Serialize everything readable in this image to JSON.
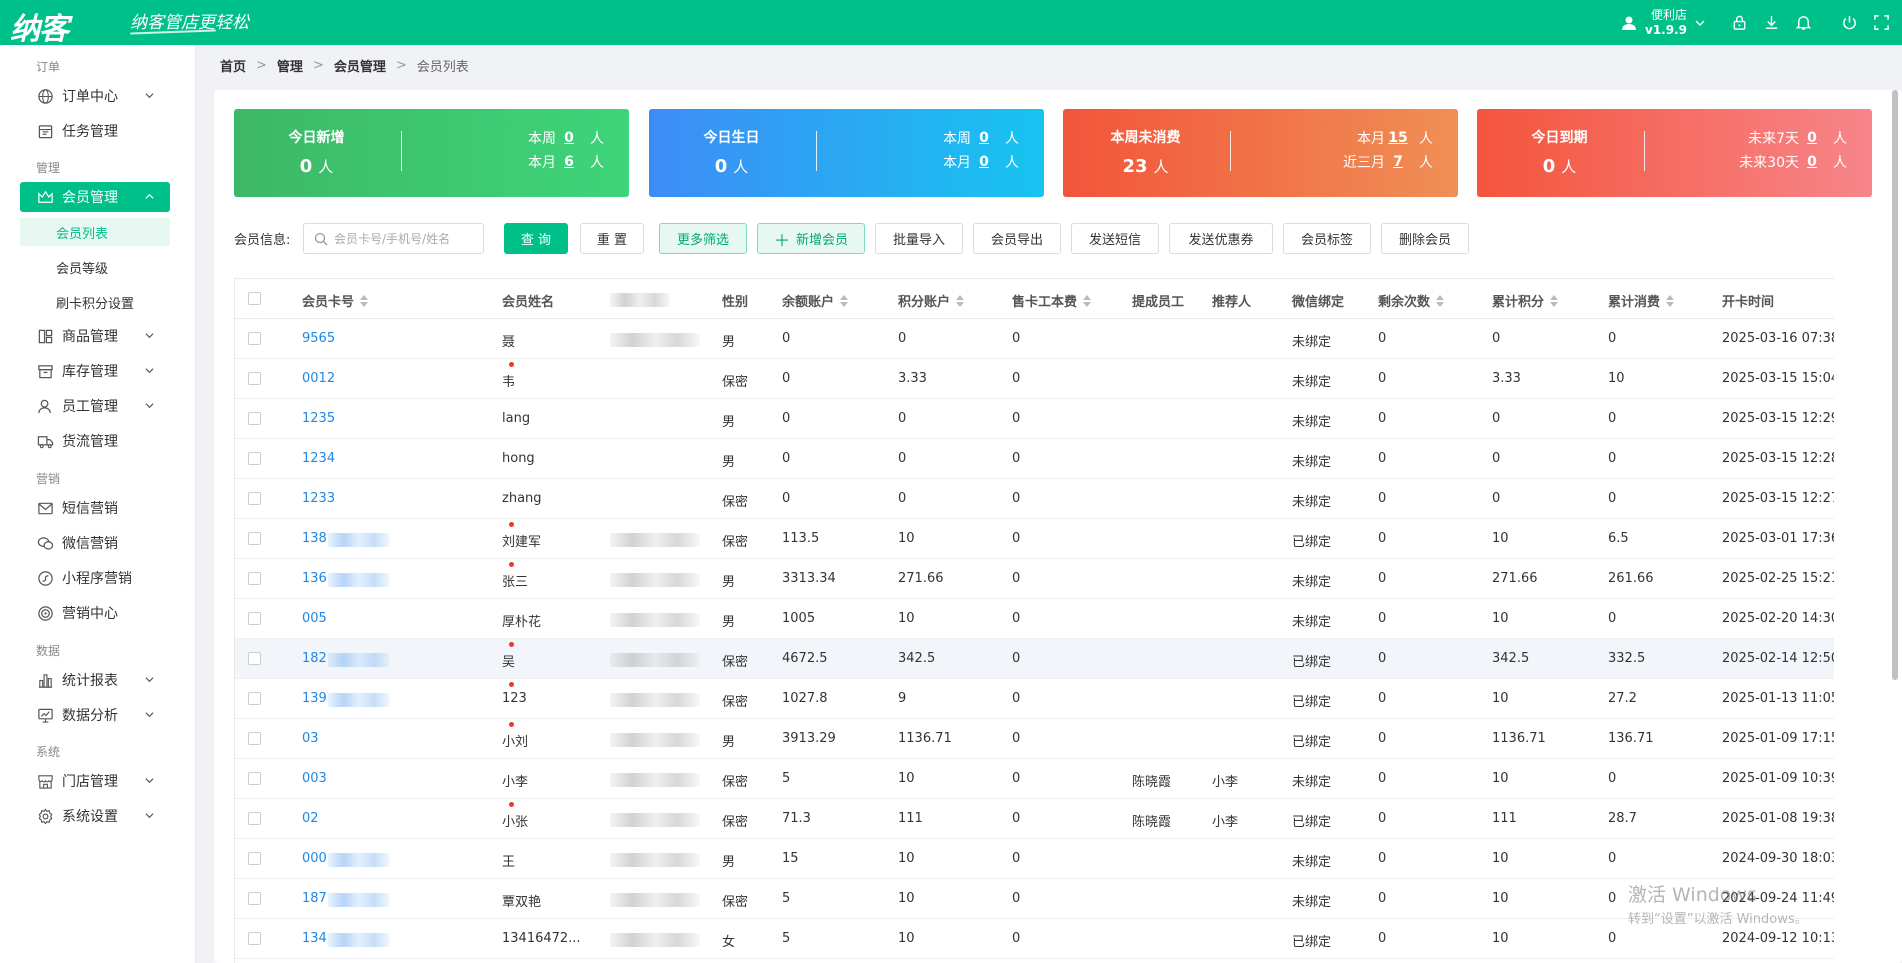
{
  "brand": {
    "logo": "纳客",
    "slogan": "纳客管店更轻松"
  },
  "user": {
    "store": "便利店",
    "version": "v1.9.9"
  },
  "sidebar": {
    "sections": {
      "order": "订单",
      "manage": "管理",
      "marketing": "营销",
      "data": "数据",
      "system": "系统"
    },
    "items": {
      "order_center": "订单中心",
      "task_manage": "任务管理",
      "member_manage": "会员管理",
      "member_list": "会员列表",
      "member_level": "会员等级",
      "card_points": "刷卡积分设置",
      "goods_manage": "商品管理",
      "stock_manage": "库存管理",
      "staff_manage": "员工管理",
      "logistics": "货流管理",
      "sms_marketing": "短信营销",
      "wechat_marketing": "微信营销",
      "mini_marketing": "小程序营销",
      "marketing_center": "营销中心",
      "reports": "统计报表",
      "analysis": "数据分析",
      "store_manage": "门店管理",
      "settings": "系统设置"
    }
  },
  "breadcrumb": {
    "home": "首页",
    "manage": "管理",
    "member_manage": "会员管理",
    "current": "会员列表"
  },
  "stats": {
    "new_today": {
      "title": "今日新增",
      "value": "0",
      "unit": "人",
      "r1_label": "本周",
      "r1_value": "0",
      "r1_unit": "人",
      "r2_label": "本月",
      "r2_value": "6",
      "r2_unit": "人",
      "color_from": "#3db867",
      "color_to": "#3ed47a"
    },
    "birthday_today": {
      "title": "今日生日",
      "value": "0",
      "unit": "人",
      "r1_label": "本周",
      "r1_value": "0",
      "r1_unit": "人",
      "r2_label": "本月",
      "r2_value": "0",
      "r2_unit": "人",
      "color_from": "#3d8cf6",
      "color_to": "#17c4f0"
    },
    "no_consume": {
      "title": "本周未消费",
      "value": "23",
      "unit": "人",
      "r1_label": "本月",
      "r1_value": "15",
      "r1_unit": "人",
      "r2_label": "近三月",
      "r2_value": "7",
      "r2_unit": "人",
      "color_from": "#f2553a",
      "color_to": "#f08f55"
    },
    "expire_today": {
      "title": "今日到期",
      "value": "0",
      "unit": "人",
      "r1_label": "未来7天",
      "r1_value": "0",
      "r1_unit": "人",
      "r2_label": "未来30天",
      "r2_value": "0",
      "r2_unit": "人",
      "color_from": "#f4553c",
      "color_to": "#f7858a"
    }
  },
  "toolbar": {
    "label": "会员信息:",
    "search_placeholder": "会员卡号/手机号/姓名",
    "query": "查 询",
    "reset": "重 置",
    "more_filter": "更多筛选",
    "add_member": "新增会员",
    "batch_import": "批量导入",
    "export": "会员导出",
    "send_sms": "发送短信",
    "send_coupon": "发送优惠券",
    "member_tag": "会员标签",
    "delete_member": "删除会员"
  },
  "table": {
    "headers": {
      "card": "会员卡号",
      "name": "会员姓名",
      "gender": "性别",
      "balance": "余额账户",
      "points": "积分账户",
      "labor_fee": "售卡工本费",
      "commission_staff": "提成员工",
      "referrer": "推荐人",
      "wechat": "微信绑定",
      "remaining": "剩余次数",
      "total_points": "累计积分",
      "total_consume": "累计消费",
      "open_time": "开卡时间"
    },
    "rows": [
      {
        "card": "9565",
        "name": "聂",
        "gender": "男",
        "balance": "0",
        "points": "0",
        "fee": "0",
        "staff": "",
        "ref": "",
        "wechat": "未绑定",
        "remain": "0",
        "tpoints": "0",
        "tconsume": "0",
        "time": "2025-03-16 07:38:"
      },
      {
        "card": "0012",
        "name": "韦",
        "gender": "保密",
        "balance": "0",
        "points": "3.33",
        "fee": "0",
        "staff": "",
        "ref": "",
        "wechat": "未绑定",
        "remain": "0",
        "tpoints": "3.33",
        "tconsume": "10",
        "time": "2025-03-15 15:04:"
      },
      {
        "card": "1235",
        "name": "lang",
        "gender": "男",
        "balance": "0",
        "points": "0",
        "fee": "0",
        "staff": "",
        "ref": "",
        "wechat": "未绑定",
        "remain": "0",
        "tpoints": "0",
        "tconsume": "0",
        "time": "2025-03-15 12:29:"
      },
      {
        "card": "1234",
        "name": "hong",
        "gender": "男",
        "balance": "0",
        "points": "0",
        "fee": "0",
        "staff": "",
        "ref": "",
        "wechat": "未绑定",
        "remain": "0",
        "tpoints": "0",
        "tconsume": "0",
        "time": "2025-03-15 12:28:"
      },
      {
        "card": "1233",
        "name": "zhang",
        "gender": "保密",
        "balance": "0",
        "points": "0",
        "fee": "0",
        "staff": "",
        "ref": "",
        "wechat": "未绑定",
        "remain": "0",
        "tpoints": "0",
        "tconsume": "0",
        "time": "2025-03-15 12:27:"
      },
      {
        "card": "138",
        "name": "刘建军",
        "gender": "保密",
        "balance": "113.5",
        "points": "10",
        "fee": "0",
        "staff": "",
        "ref": "",
        "wechat": "已绑定",
        "remain": "0",
        "tpoints": "10",
        "tconsume": "6.5",
        "time": "2025-03-01 17:36:"
      },
      {
        "card": "136",
        "name": "张三",
        "gender": "男",
        "balance": "3313.34",
        "points": "271.66",
        "fee": "0",
        "staff": "",
        "ref": "",
        "wechat": "未绑定",
        "remain": "0",
        "tpoints": "271.66",
        "tconsume": "261.66",
        "time": "2025-02-25 15:21:"
      },
      {
        "card": "005",
        "name": "厚朴花",
        "gender": "男",
        "balance": "1005",
        "points": "10",
        "fee": "0",
        "staff": "",
        "ref": "",
        "wechat": "未绑定",
        "remain": "0",
        "tpoints": "10",
        "tconsume": "0",
        "time": "2025-02-20 14:30:"
      },
      {
        "card": "182",
        "name": "吴",
        "gender": "保密",
        "balance": "4672.5",
        "points": "342.5",
        "fee": "0",
        "staff": "",
        "ref": "",
        "wechat": "已绑定",
        "remain": "0",
        "tpoints": "342.5",
        "tconsume": "332.5",
        "time": "2025-02-14 12:50:"
      },
      {
        "card": "139",
        "name": "123",
        "gender": "保密",
        "balance": "1027.8",
        "points": "9",
        "fee": "0",
        "staff": "",
        "ref": "",
        "wechat": "已绑定",
        "remain": "0",
        "tpoints": "10",
        "tconsume": "27.2",
        "time": "2025-01-13 11:05:"
      },
      {
        "card": "03",
        "name": "小刘",
        "gender": "男",
        "balance": "3913.29",
        "points": "1136.71",
        "fee": "0",
        "staff": "",
        "ref": "",
        "wechat": "已绑定",
        "remain": "0",
        "tpoints": "1136.71",
        "tconsume": "136.71",
        "time": "2025-01-09 17:15:"
      },
      {
        "card": "003",
        "name": "小李",
        "gender": "保密",
        "balance": "5",
        "points": "10",
        "fee": "0",
        "staff": "陈晓霞",
        "ref": "小李",
        "wechat": "未绑定",
        "remain": "0",
        "tpoints": "10",
        "tconsume": "0",
        "time": "2025-01-09 10:39:"
      },
      {
        "card": "02",
        "name": "小张",
        "gender": "保密",
        "balance": "71.3",
        "points": "111",
        "fee": "0",
        "staff": "陈晓霞",
        "ref": "小李",
        "wechat": "已绑定",
        "remain": "0",
        "tpoints": "111",
        "tconsume": "28.7",
        "time": "2025-01-08 19:38:"
      },
      {
        "card": "000",
        "name": "王",
        "gender": "男",
        "balance": "15",
        "points": "10",
        "fee": "0",
        "staff": "",
        "ref": "",
        "wechat": "未绑定",
        "remain": "0",
        "tpoints": "10",
        "tconsume": "0",
        "time": "2024-09-30 18:03:"
      },
      {
        "card": "187",
        "name": "覃双艳",
        "gender": "保密",
        "balance": "5",
        "points": "10",
        "fee": "0",
        "staff": "",
        "ref": "",
        "wechat": "未绑定",
        "remain": "0",
        "tpoints": "10",
        "tconsume": "0",
        "time": "2024-09-24 11:49:"
      },
      {
        "card": "134",
        "name": "13416472...",
        "gender": "女",
        "balance": "5",
        "points": "10",
        "fee": "0",
        "staff": "",
        "ref": "",
        "wechat": "已绑定",
        "remain": "0",
        "tpoints": "10",
        "tconsume": "0",
        "time": "2024-09-12 10:13:"
      }
    ]
  },
  "watermark": {
    "line1": "激活 Windows",
    "line2": "转到“设置”以激活 Windows。"
  }
}
